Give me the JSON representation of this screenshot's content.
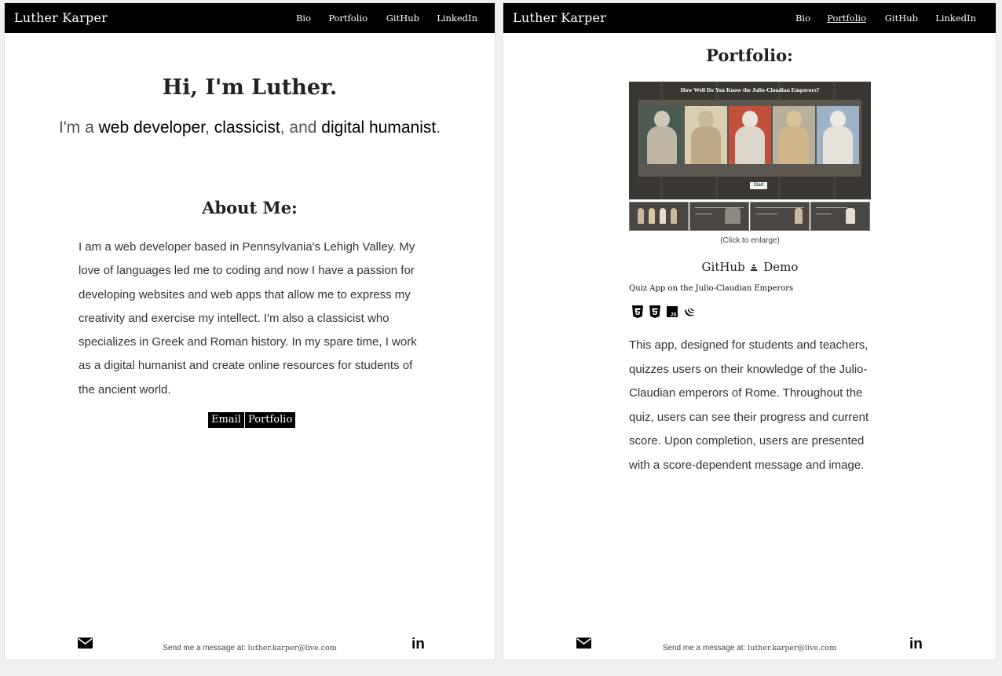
{
  "left": {
    "brand": "Luther Karper",
    "nav": [
      "Bio",
      "Portfolio",
      "GitHub",
      "LinkedIn"
    ],
    "hero": {
      "heading": "Hi, I'm Luther.",
      "sub_prefix": "I'm a ",
      "role1": "web developer",
      "comma": ", ",
      "role2": "classicist",
      "and": ", and ",
      "role3": "digital humanist",
      "period": "."
    },
    "about": {
      "heading": "About Me:",
      "text": "I am a web developer based in Pennsylvania's Lehigh Valley. My love of languages led me to coding and now I have a passion for developing websites and web apps that allow me to express my creativity and exercise my intellect. I'm also a classicist who specializes in Greek and Roman history. In my spare time, I work as a digital humanist and create online resources for students of the ancient world."
    },
    "buttons": {
      "email": "Email",
      "portfolio": "Portfolio"
    }
  },
  "right": {
    "brand": "Luther Karper",
    "nav": [
      "Bio",
      "Portfolio",
      "GitHub",
      "LinkedIn"
    ],
    "active_nav": "Portfolio",
    "portfolio_heading": "Portfolio:",
    "project": {
      "image_title": "How Well Do You Know the Julio-Claudian Emperors?",
      "start_label": "Start",
      "caption": "(Click to enlarge)",
      "github_label": "GitHub",
      "demo_label": "Demo",
      "name": "Quiz App on the Julio-Claudian Emperors",
      "tech_icons": [
        "html5-icon",
        "css3-icon",
        "javascript-icon",
        "jquery-icon"
      ],
      "description": "This app, designed for students and teachers, quizzes users on their knowledge of the Julio-Claudian emperors of Rome. Throughout the quiz, users can see their progress and current score. Upon completion, users are presented with a score-dependent message and image."
    }
  },
  "footer": {
    "prefix": "Send me a message at: ",
    "email": "luther.karper@live.com",
    "mail_icon": "envelope-icon",
    "linkedin_glyph": "in"
  },
  "colors": {
    "navbar": "#000000",
    "page": "#ffffff",
    "text": "#333333"
  }
}
